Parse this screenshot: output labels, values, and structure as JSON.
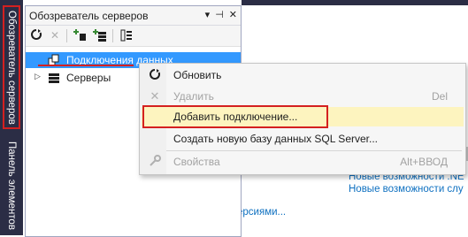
{
  "vertical_tabs": {
    "server_explorer": "Обозреватель серверов",
    "toolbox": "Панель элементов"
  },
  "panel": {
    "title": "Обозреватель серверов",
    "controls": {
      "dropdown": "▾",
      "pin": "⊣",
      "close": "✕"
    }
  },
  "toolbar": {
    "refresh_icon": "refresh-icon",
    "stop_icon": "stop-icon",
    "connect_icon": "connect-to-database-icon",
    "connect_server_icon": "connect-to-server-icon",
    "properties_icon": "properties-icon"
  },
  "tree": {
    "items": [
      {
        "label": "Подключения данных",
        "selected": true
      },
      {
        "label": "Серверы",
        "selected": false
      }
    ]
  },
  "context_menu": {
    "items": [
      {
        "label": "Обновить",
        "shortcut": "",
        "icon": "refresh-icon",
        "enabled": true
      },
      {
        "label": "Удалить",
        "shortcut": "Del",
        "icon": "delete-icon",
        "enabled": false
      },
      {
        "label": "Добавить подключение...",
        "shortcut": "",
        "icon": "",
        "enabled": true,
        "highlighted": true
      },
      {
        "label": "Создать новую базу данных SQL Server...",
        "shortcut": "",
        "icon": "",
        "enabled": true
      },
      {
        "label": "Свойства",
        "shortcut": "Alt+ВВОД",
        "icon": "wrench-icon",
        "enabled": false
      }
    ]
  },
  "right_pane": {
    "links": [
      "Новые возможности .NE",
      "Новые возможности слу"
    ],
    "partial_link": "ерсиями..."
  },
  "colors": {
    "strip": "#2b2d45",
    "selection": "#3399ff",
    "highlight": "#fdf4bf",
    "annotation_red": "#d42020",
    "link": "#0e70c0"
  }
}
